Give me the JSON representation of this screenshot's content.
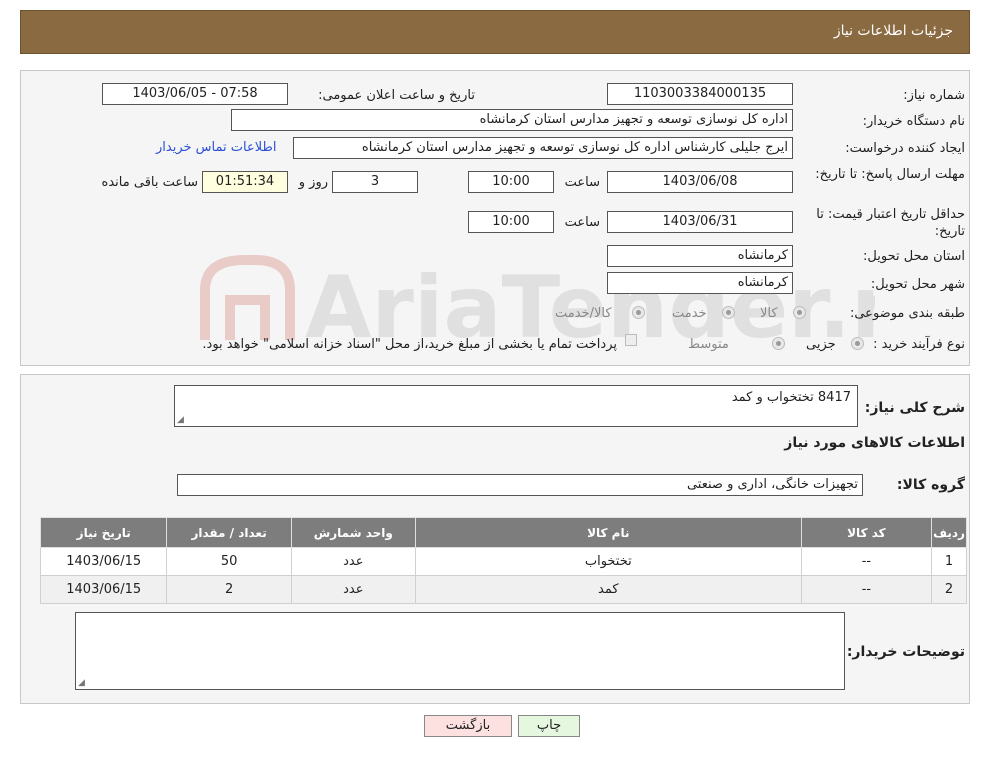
{
  "header": {
    "title": "جزئیات اطلاعات نیاز"
  },
  "fields": {
    "need_number_label": "شماره نیاز:",
    "need_number": "1103003384000135",
    "announce_label": "تاریخ و ساعت اعلان عمومی:",
    "announce_value": "1403/06/05 - 07:58",
    "buyer_org_label": "نام دستگاه خریدار:",
    "buyer_org": "اداره کل نوسازی  توسعه و تجهیز مدارس استان کرمانشاه",
    "creator_label": "ایجاد کننده درخواست:",
    "creator": "ایرج جلیلی کارشناس اداره کل نوسازی  توسعه و تجهیز مدارس استان کرمانشاه",
    "contact_link": "اطلاعات تماس خریدار",
    "deadline_label": "مهلت ارسال پاسخ: تا تاریخ:",
    "deadline_date": "1403/06/08",
    "time_label": "ساعت",
    "deadline_time": "10:00",
    "days_value": "3",
    "days_label": "روز و",
    "remaining_time": "01:51:34",
    "remaining_label": "ساعت باقی مانده",
    "validity_label": "حداقل تاریخ اعتبار قیمت: تا تاریخ:",
    "validity_date": "1403/06/31",
    "validity_time": "10:00",
    "province_label": "استان محل تحویل:",
    "province": "کرمانشاه",
    "city_label": "شهر محل تحویل:",
    "city": "کرمانشاه",
    "category_label": "طبقه بندی موضوعی:",
    "category_options": [
      "کالا",
      "خدمت",
      "کالا/خدمت"
    ],
    "purchase_type_label": "نوع فرآیند خرید :",
    "purchase_options": [
      "جزیی",
      "متوسط"
    ],
    "payment_note": "پرداخت تمام یا بخشی از مبلغ خرید،از محل \"اسناد خزانه اسلامی\" خواهد بود."
  },
  "summary": {
    "label": "شرح کلی نیاز:",
    "value": "8417 تختخواب و کمد",
    "items_heading": "اطلاعات کالاهای مورد نیاز",
    "group_label": "گروه کالا:",
    "group_value": "تجهیزات خانگی، اداری و صنعتی"
  },
  "table": {
    "headers": [
      "ردیف",
      "کد کالا",
      "نام کالا",
      "واحد شمارش",
      "تعداد / مقدار",
      "تاریخ نیاز"
    ],
    "rows": [
      [
        "1",
        "--",
        "تختخواب",
        "عدد",
        "50",
        "1403/06/15"
      ],
      [
        "2",
        "--",
        "کمد",
        "عدد",
        "2",
        "1403/06/15"
      ]
    ]
  },
  "buyer_notes": {
    "label": "توضیحات خریدار:",
    "value": ""
  },
  "buttons": {
    "print": "چاپ",
    "back": "بازگشت"
  },
  "watermark": {
    "text": "AriaTender.neT"
  },
  "colors": {
    "header_bg": "#8a6a40",
    "link": "#2a4fd6",
    "table_header": "#7d7d7d"
  }
}
